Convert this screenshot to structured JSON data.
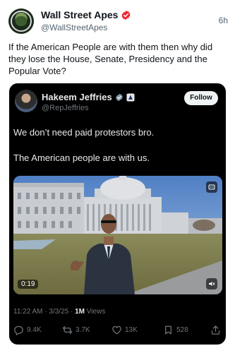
{
  "outer_post": {
    "author_name": "Wall Street Apes",
    "handle": "@WallStreetApes",
    "time": "6h",
    "text": "If the American People are with them then why did they lose the House, Senate, Presidency and the Popular Vote?"
  },
  "quoted_post": {
    "author_name": "Hakeem Jeffries",
    "handle": "@RepJeffries",
    "follow_label": "Follow",
    "line1": "We don’t need paid protestors bro.",
    "line2": "The American people are with us.",
    "video_duration": "0:19",
    "timestamp": "11:22 AM · 3/3/25 · ",
    "views_count": "1M",
    "views_label": " Views",
    "replies": "9.4K",
    "reposts": "3.7K",
    "likes": "13K",
    "bookmarks": "528"
  },
  "colors": {
    "verified_red": "#f4212e",
    "verified_blue": "#1d9bf0",
    "card_bg": "#000000"
  },
  "icons": [
    "verified-badge-icon",
    "gov-badge-icon",
    "caption-icon",
    "volume-icon",
    "reply-icon",
    "repost-icon",
    "like-icon",
    "bookmark-icon",
    "share-icon"
  ]
}
